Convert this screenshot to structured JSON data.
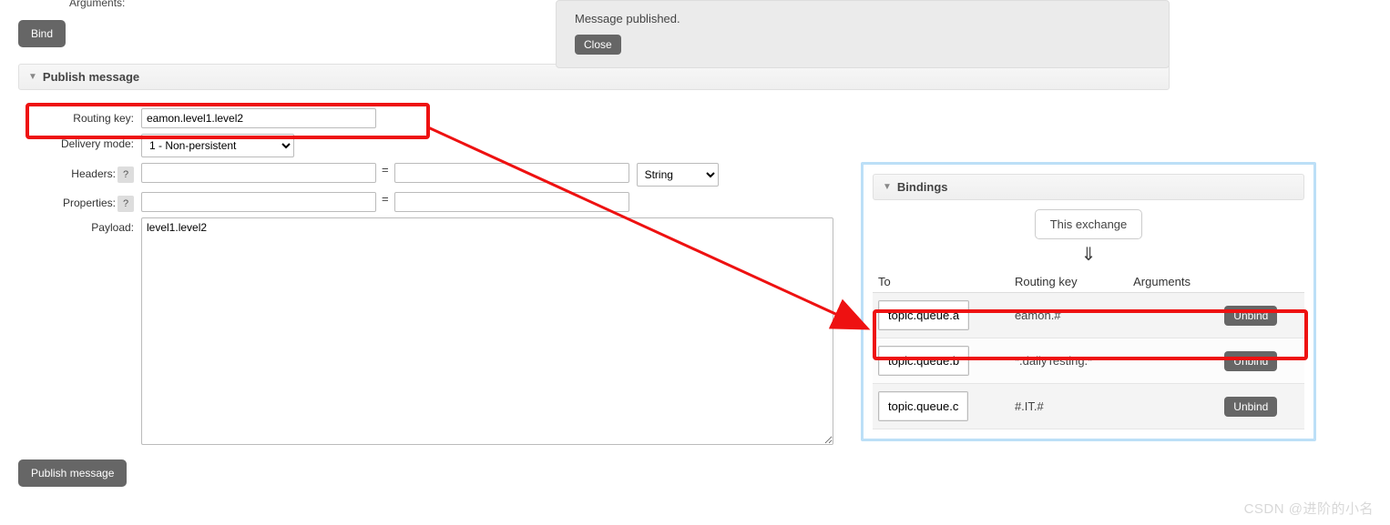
{
  "top": {
    "arguments_label": "Arguments:",
    "type_sel": "String"
  },
  "bind_btn": "Bind",
  "notice": {
    "text": "Message published.",
    "close": "Close"
  },
  "publish": {
    "header": "Publish message",
    "routing_key_label": "Routing key:",
    "routing_key_value": "eamon.level1.level2",
    "delivery_mode_label": "Delivery mode:",
    "delivery_mode_value": "1 - Non-persistent",
    "headers_label": "Headers:",
    "headers_type": "String",
    "properties_label": "Properties:",
    "payload_label": "Payload:",
    "payload_value": "level1.level2",
    "submit": "Publish message"
  },
  "bindings": {
    "header": "Bindings",
    "this_exchange": "This exchange",
    "cols": {
      "to": "To",
      "rk": "Routing key",
      "args": "Arguments"
    },
    "rows": [
      {
        "queue": "topic.queue.a",
        "rk": "eamon.#",
        "args": "",
        "unbind": "Unbind"
      },
      {
        "queue": "topic.queue.b",
        "rk": "*.dailyTesting.*",
        "args": "",
        "unbind": "Unbind"
      },
      {
        "queue": "topic.queue.c",
        "rk": "#.IT.#",
        "args": "",
        "unbind": "Unbind"
      }
    ]
  },
  "watermark": "CSDN @进阶的小名"
}
